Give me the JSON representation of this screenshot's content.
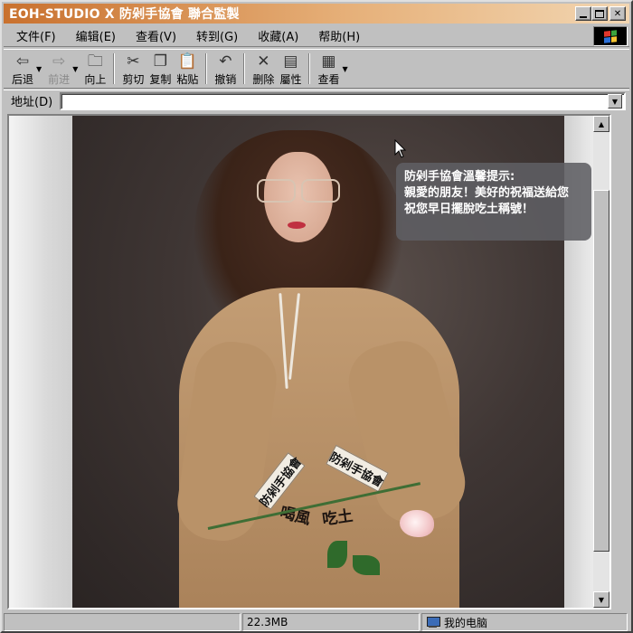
{
  "window": {
    "title": "EOH-STUDIO X 防剁手協會 聯合監製",
    "title_bar_color": "#c9712e"
  },
  "menu": {
    "items": [
      "文件(F)",
      "编辑(E)",
      "查看(V)",
      "转到(G)",
      "收藏(A)",
      "帮助(H)"
    ]
  },
  "toolbar": {
    "back": "后退",
    "forward": "前进",
    "up": "向上",
    "cut": "剪切",
    "copy": "复制",
    "paste": "粘贴",
    "undo": "撤销",
    "delete": "删除",
    "properties": "屬性",
    "view": "查看"
  },
  "address": {
    "label": "地址(D)",
    "value": ""
  },
  "content": {
    "tooltip_lines": [
      "防剁手協會溫馨提示:",
      "親愛的朋友！美好的祝福送給您",
      "祝您早日擺脫吃土稱號！"
    ],
    "cuff_left_text": "防剁手協會",
    "cuff_right_text": "防剁手協會",
    "hand_left_text": "喝風",
    "hand_right_text": "吃土"
  },
  "status": {
    "panel1": "",
    "size": "22.3MB",
    "location": "我的电脑"
  },
  "icons": {
    "back": "arrow-left-icon",
    "forward": "arrow-right-icon",
    "up": "folder-up-icon",
    "cut": "scissors-icon",
    "copy": "copy-icon",
    "paste": "paste-icon",
    "undo": "undo-icon",
    "delete": "delete-x-icon",
    "properties": "properties-icon",
    "view": "view-grid-icon",
    "computer": "computer-icon"
  }
}
